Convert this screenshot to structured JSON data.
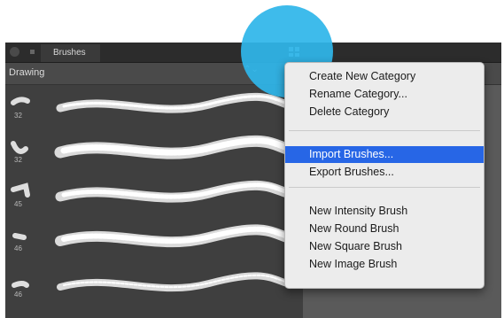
{
  "panel": {
    "tab_label": "Brushes",
    "category": "Drawing",
    "category_arrows": "⌃⌄"
  },
  "brushes": [
    {
      "size": "32"
    },
    {
      "size": "32"
    },
    {
      "size": "45"
    },
    {
      "size": "46"
    },
    {
      "size": "46"
    }
  ],
  "menu": {
    "items": [
      {
        "label": "Create New Category",
        "highlighted": false
      },
      {
        "label": "Rename Category...",
        "highlighted": false
      },
      {
        "label": "Delete Category",
        "highlighted": false
      },
      {
        "label": "Import Brushes...",
        "highlighted": true
      },
      {
        "label": "Export Brushes...",
        "highlighted": false
      },
      {
        "label": "New Intensity Brush",
        "highlighted": false
      },
      {
        "label": "New Round Brush",
        "highlighted": false
      },
      {
        "label": "New Square Brush",
        "highlighted": false
      },
      {
        "label": "New Image Brush",
        "highlighted": false
      }
    ]
  },
  "colors": {
    "highlight": "#2766e6",
    "pointer": "#2fb6ea",
    "panel_bg": "#3f3f3f"
  }
}
